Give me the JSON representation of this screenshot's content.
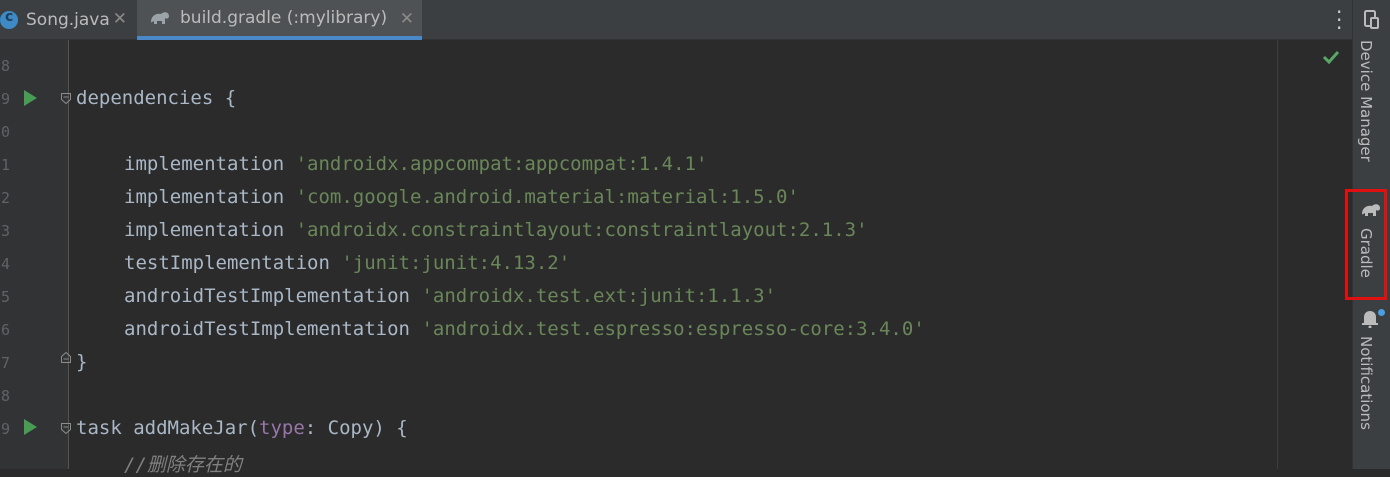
{
  "tabs": [
    {
      "label": "Song.java",
      "icon": "java-class-icon",
      "close": "✕"
    },
    {
      "label": "build.gradle (:mylibrary)",
      "icon": "gradle-elephant-icon",
      "close": "✕"
    }
  ],
  "editor": {
    "line_numbers": [
      "8",
      "9",
      "0",
      "1",
      "2",
      "3",
      "4",
      "5",
      "6",
      "7",
      "8",
      "9",
      ""
    ],
    "lines": {
      "dependencies": {
        "kw": "dependencies",
        "brace": " {"
      },
      "impl1": {
        "kw": "implementation",
        "str": "'androidx.appcompat:appcompat:1.4.1'"
      },
      "impl2": {
        "kw": "implementation",
        "str": "'com.google.android.material:material:1.5.0'"
      },
      "impl3": {
        "kw": "implementation",
        "str": "'androidx.constraintlayout:constraintlayout:2.1.3'"
      },
      "test1": {
        "kw": "testImplementation",
        "str": "'junit:junit:4.13.2'"
      },
      "atest1": {
        "kw": "androidTestImplementation",
        "str": "'androidx.test.ext:junit:1.1.3'"
      },
      "atest2": {
        "kw": "androidTestImplementation",
        "str": "'androidx.test.espresso:espresso-core:3.4.0'"
      },
      "close": "}",
      "task": {
        "pre": "task addMakeJar(",
        "param": "type",
        "post": ": Copy) {"
      },
      "comment": "//删除存在的"
    }
  },
  "sidebar": {
    "device_manager": "Device Manager",
    "gradle": "Gradle",
    "notifications": "Notifications"
  },
  "colors": {
    "background": "#2b2b2b",
    "string": "#6a8759",
    "keyword_text": "#a9b7c6",
    "param": "#9876aa",
    "run_arrow": "#499c54",
    "highlight_box": "#e01010",
    "tab_underline": "#4a88c7"
  }
}
